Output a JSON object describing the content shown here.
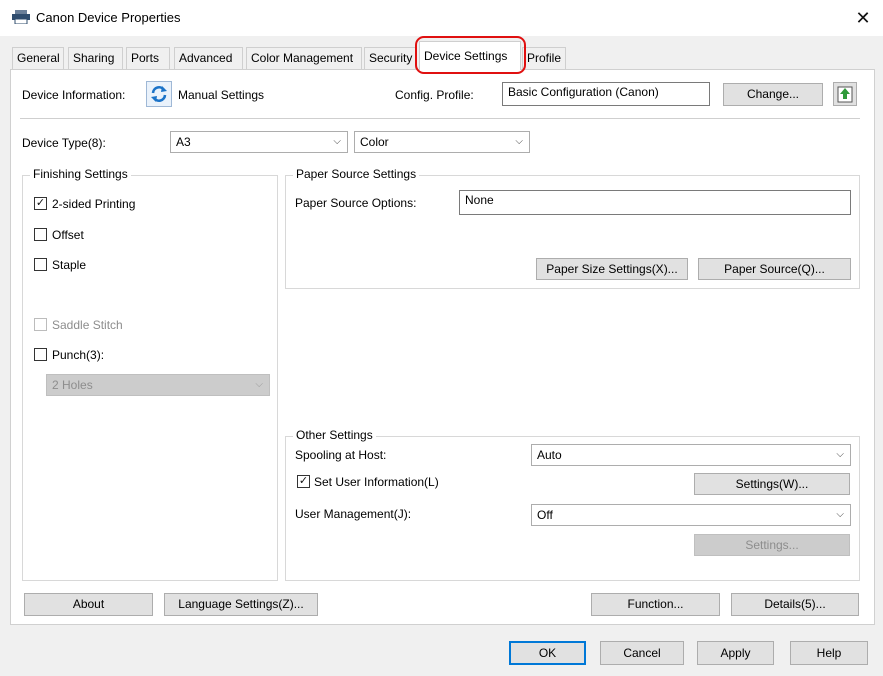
{
  "window": {
    "title": "Canon Device Properties",
    "close": "✕"
  },
  "tabs": [
    {
      "label": "General"
    },
    {
      "label": "Sharing"
    },
    {
      "label": "Ports"
    },
    {
      "label": "Advanced"
    },
    {
      "label": "Color Management"
    },
    {
      "label": "Security"
    },
    {
      "label": "Device Settings"
    },
    {
      "label": "Profile"
    }
  ],
  "header": {
    "device_info_label": "Device Information:",
    "device_info_value": "Manual Settings",
    "config_profile_label": "Config. Profile:",
    "config_profile_value": "Basic Configuration (Canon)",
    "change_button": "Change..."
  },
  "device_type": {
    "label": "Device Type(8):",
    "size_value": "A3",
    "color_value": "Color"
  },
  "finishing": {
    "title": "Finishing Settings",
    "two_sided": "2-sided Printing",
    "offset": "Offset",
    "staple": "Staple",
    "saddle_stitch": "Saddle Stitch",
    "punch": "Punch(3):",
    "punch_value": "2 Holes"
  },
  "paper_source": {
    "title": "Paper Source Settings",
    "options_label": "Paper Source Options:",
    "options_value": "None",
    "size_settings_button": "Paper Size Settings(X)...",
    "source_button": "Paper Source(Q)..."
  },
  "other": {
    "title": "Other Settings",
    "spooling_label": "Spooling at Host:",
    "spooling_value": "Auto",
    "set_user_info": "Set User Information(L)",
    "settings_w_button": "Settings(W)...",
    "user_mgmt_label": "User Management(J):",
    "user_mgmt_value": "Off",
    "settings_disabled_button": "Settings..."
  },
  "panel_buttons": {
    "about": "About",
    "language": "Language Settings(Z)...",
    "function": "Function...",
    "details": "Details(5)..."
  },
  "dialog_buttons": {
    "ok": "OK",
    "cancel": "Cancel",
    "apply": "Apply",
    "help": "Help"
  },
  "glyphs": {
    "check": "✓",
    "chevron": "⌵"
  },
  "icons": {
    "printer": "printer-icon",
    "refresh": "refresh-icon",
    "upload": "upload-icon"
  },
  "colors": {
    "tab_highlight": "#e01010",
    "accent_icon": "#1b73c8",
    "upload_green": "#2f9a3a"
  }
}
